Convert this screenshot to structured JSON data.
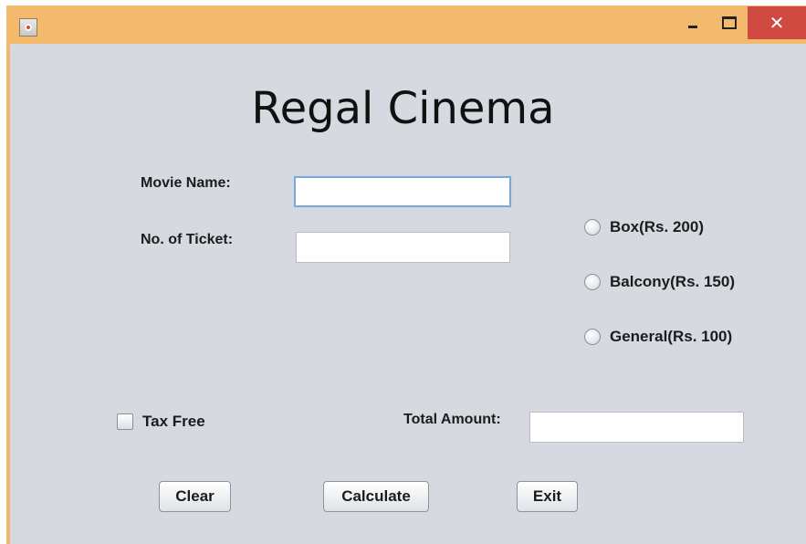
{
  "window": {
    "icon": "java-app-icon",
    "controls": {
      "close_glyph": "✕"
    }
  },
  "form": {
    "heading": "Regal Cinema",
    "movie_name_label": "Movie Name:",
    "movie_name_value": "",
    "tickets_label": "No. of Ticket:",
    "tickets_value": "",
    "categories": [
      {
        "label": "Box(Rs. 200)",
        "selected": false
      },
      {
        "label": "Balcony(Rs. 150)",
        "selected": false
      },
      {
        "label": "General(Rs. 100)",
        "selected": false
      }
    ],
    "tax_free_label": "Tax Free",
    "tax_free_checked": false,
    "total_amount_label": "Total Amount:",
    "total_amount_value": ""
  },
  "buttons": {
    "clear": "Clear",
    "calculate": "Calculate",
    "exit": "Exit"
  },
  "colors": {
    "titlebar": "#f3b96d",
    "close_button": "#d04a42",
    "content_background": "#d6d9e0"
  }
}
